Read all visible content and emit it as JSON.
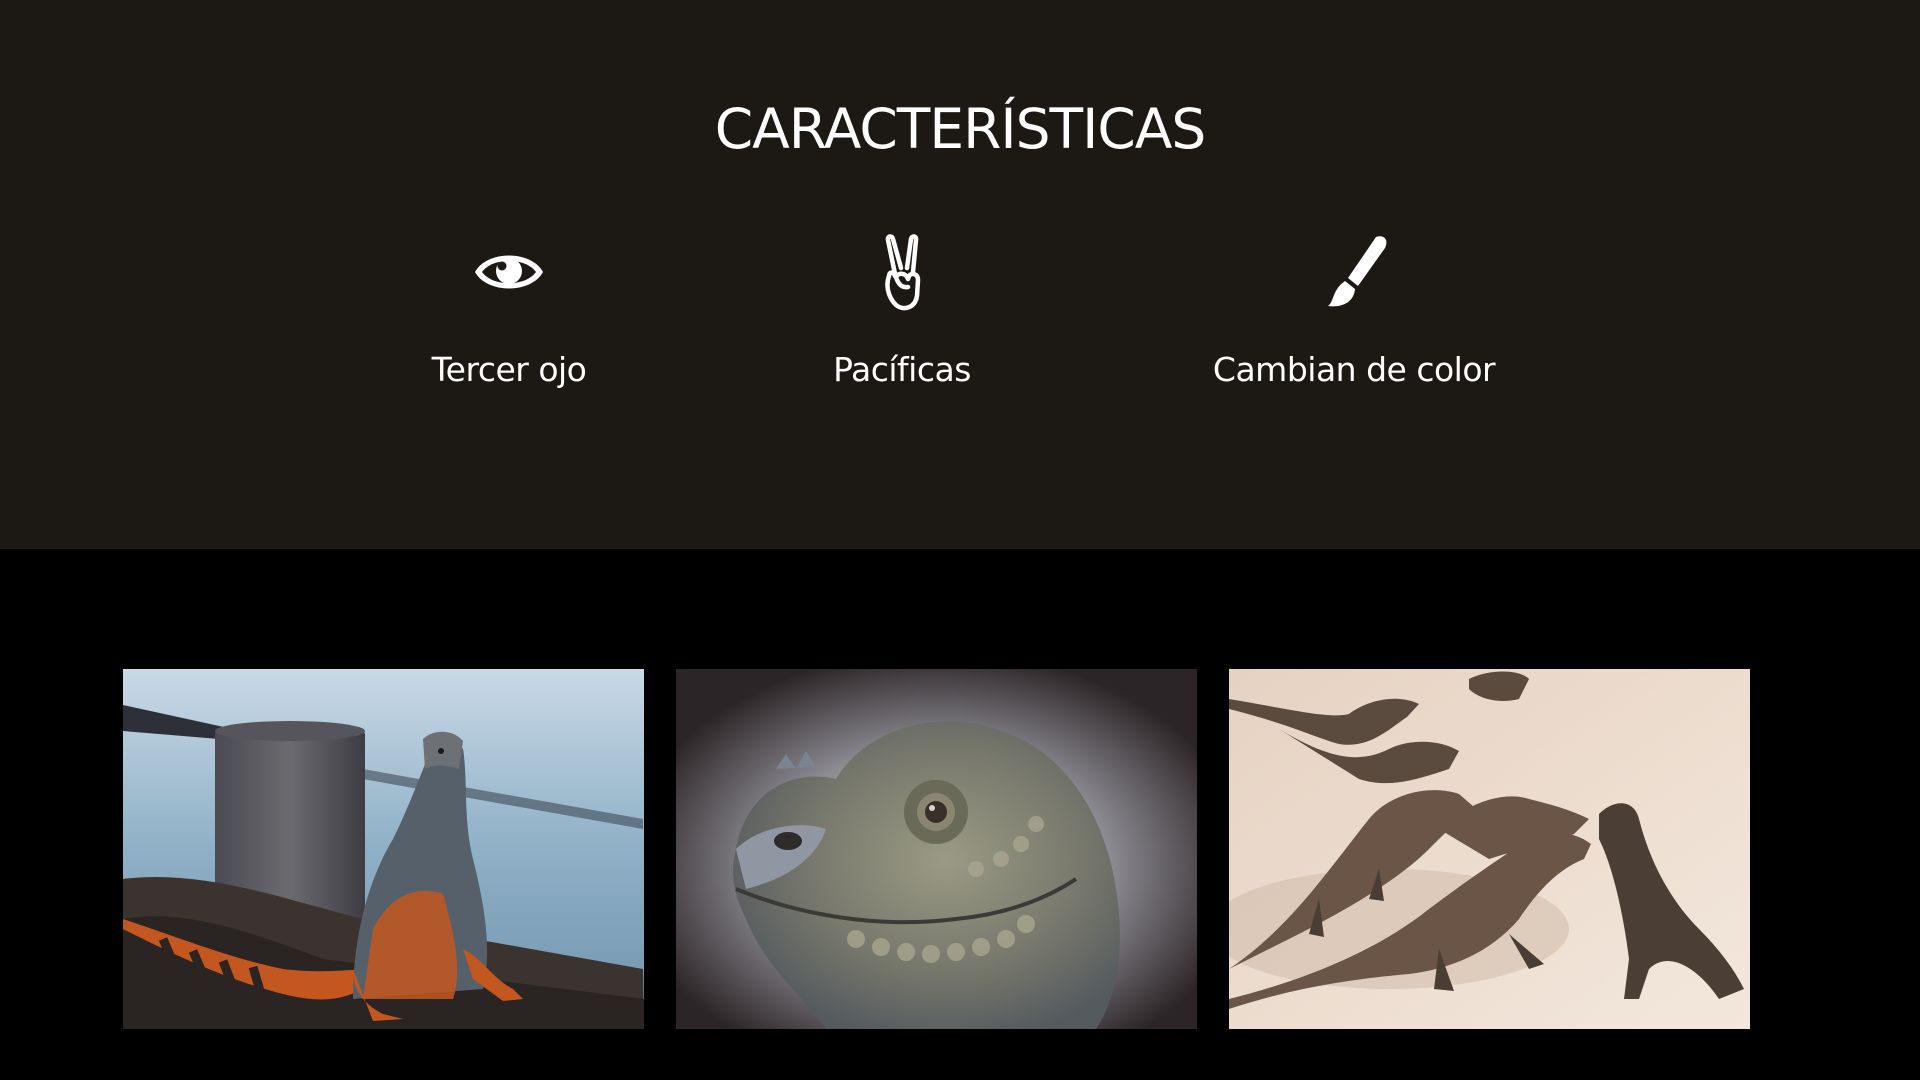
{
  "features": {
    "title": "CARACTERÍSTICAS",
    "background": "#1c1814",
    "items": [
      {
        "icon": "eye-icon",
        "label": "Tercer ojo"
      },
      {
        "icon": "peace-hand-icon",
        "label": "Pacíficas"
      },
      {
        "icon": "paintbrush-icon",
        "label": "Cambian de color"
      }
    ]
  },
  "gallery": {
    "background": "#000000",
    "photos": [
      {
        "subject": "orange-striped iguana on rocks by the water"
      },
      {
        "subject": "close-up of a grey iguana head"
      },
      {
        "subject": "group of iguanas on sand"
      }
    ]
  }
}
